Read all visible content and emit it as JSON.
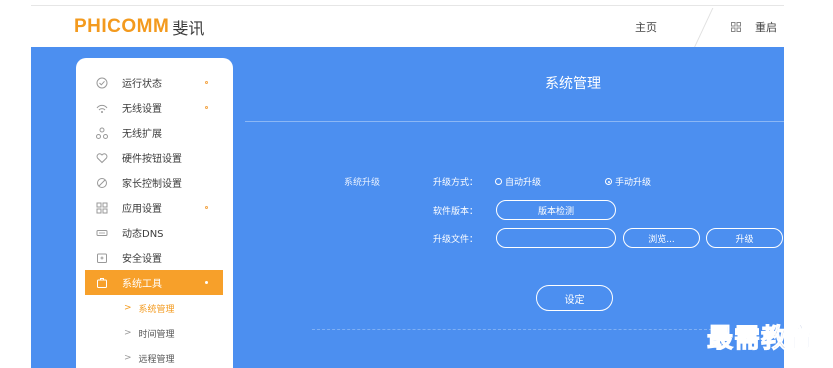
{
  "header": {
    "logo_latin": "PHICOMM",
    "logo_cn": "斐讯",
    "home": "主页",
    "reboot": "重启"
  },
  "sidebar": {
    "items": [
      {
        "label": "运行状态",
        "icon": "status-icon"
      },
      {
        "label": "无线设置",
        "icon": "wifi-icon"
      },
      {
        "label": "无线扩展",
        "icon": "network-extend-icon"
      },
      {
        "label": "硬件按钮设置",
        "icon": "heart-icon"
      },
      {
        "label": "家长控制设置",
        "icon": "parental-control-icon"
      },
      {
        "label": "应用设置",
        "icon": "apps-grid-icon"
      },
      {
        "label": "动态DNS",
        "icon": "dns-icon"
      },
      {
        "label": "安全设置",
        "icon": "security-icon"
      },
      {
        "label": "系统工具",
        "icon": "toolbox-icon"
      }
    ],
    "sub_items": [
      {
        "label": "系统管理"
      },
      {
        "label": "时间管理"
      },
      {
        "label": "远程管理"
      }
    ]
  },
  "content": {
    "title": "系统管理",
    "section_label": "系统升级",
    "upgrade_mode_label": "升级方式：",
    "auto_upgrade": "自动升级",
    "manual_upgrade": "手动升级",
    "software_version_label": "软件版本：",
    "version_check_button": "版本检测",
    "upgrade_file_label": "升级文件：",
    "upgrade_file_value": "",
    "browse_button": "浏览...",
    "upgrade_button": "升级",
    "set_button": "设定"
  },
  "watermark": "最需教育",
  "colors": {
    "brand_orange": "#f39a1e",
    "main_blue": "#4c8ff0",
    "active_item": "#f7a02a"
  }
}
